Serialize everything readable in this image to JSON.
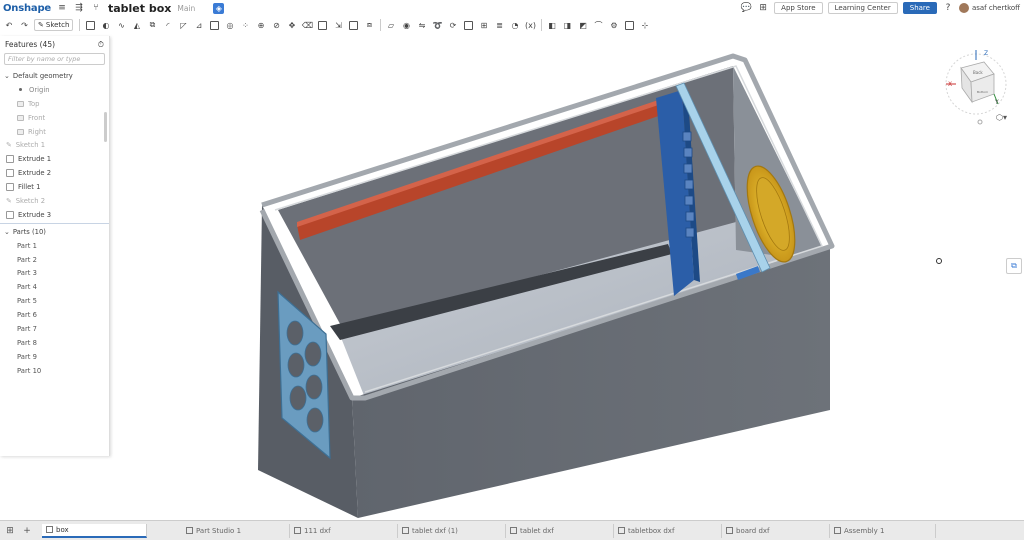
{
  "app": {
    "logo": "Onshape",
    "document_title": "tablet box",
    "branch": "Main"
  },
  "top_right": {
    "app_store": "App Store",
    "learning_center": "Learning Center",
    "share": "Share",
    "user": "asaf chertkoff"
  },
  "toolbar": {
    "sketch_label": "Sketch",
    "icons": [
      "undo-icon",
      "redo-icon",
      "sketch-icon",
      "extrude-icon",
      "revolve-icon",
      "sweep-icon",
      "loft-icon",
      "thicken-icon",
      "fillet-icon",
      "chamfer-icon",
      "draft-icon",
      "shell-icon",
      "hole-icon",
      "linear-pattern-icon",
      "circular-pattern-icon",
      "boolean-icon",
      "split-icon",
      "transform-icon",
      "delete-part-icon",
      "modify-fillet-icon",
      "move-face-icon",
      "replace-face-icon",
      "offset-surface-icon",
      "plane-icon",
      "mate-connector-icon",
      "mirror-icon",
      "helix-icon",
      "variable-icon",
      "measure-icon",
      "section-icon",
      "config-icon",
      "display-icon",
      "sheetmetal-icon",
      "frame-icon",
      "add-custom-icon"
    ]
  },
  "features": {
    "title": "Features (45)",
    "filter_placeholder": "Filter by name or type",
    "default_geometry_label": "Default geometry",
    "default_geometry": [
      {
        "label": "Origin"
      },
      {
        "label": "Top"
      },
      {
        "label": "Front"
      },
      {
        "label": "Right"
      }
    ],
    "items": [
      {
        "label": "Sketch 1",
        "dim": true
      },
      {
        "label": "Extrude 1",
        "dim": false
      },
      {
        "label": "Extrude 2",
        "dim": false
      },
      {
        "label": "Fillet 1",
        "dim": false
      },
      {
        "label": "Sketch 2",
        "dim": true
      },
      {
        "label": "Extrude 3",
        "dim": false
      }
    ],
    "parts_label": "Parts (10)",
    "parts": [
      "Part 1",
      "Part 2",
      "Part 3",
      "Part 4",
      "Part 5",
      "Part 6",
      "Part 7",
      "Part 8",
      "Part 9",
      "Part 10"
    ]
  },
  "view_cube": {
    "face_top": "Back",
    "face_front": "Bottom",
    "axis_x": "X",
    "axis_y": "Y",
    "axis_z": "Z"
  },
  "tabs": [
    {
      "label": "box",
      "active": true
    },
    {
      "label": "Part Studio 1",
      "active": false
    },
    {
      "label": "111 dxf",
      "active": false
    },
    {
      "label": "tablet dxf (1)",
      "active": false
    },
    {
      "label": "tablet dxf",
      "active": false
    },
    {
      "label": "tabletbox dxf",
      "active": false
    },
    {
      "label": "board dxf",
      "active": false
    },
    {
      "label": "Assembly 1",
      "active": false
    }
  ],
  "colors": {
    "box_gray": "#5b6068",
    "rail_orange": "#b8452a",
    "divider_blue": "#2b5ea8",
    "coin_gold": "#e0b020",
    "brand_blue": "#1e5fa8"
  }
}
